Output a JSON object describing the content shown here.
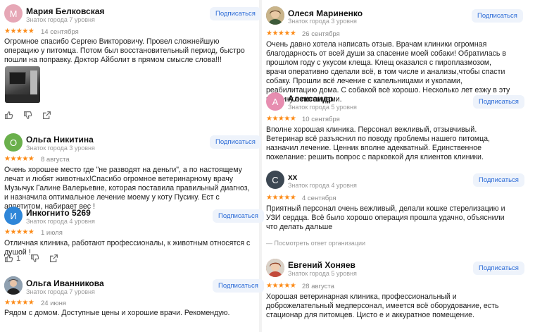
{
  "subscribe_label": "Подписаться",
  "left_reviews": [
    {
      "initial": "М",
      "avatar_color": "#e6a7b6",
      "name": "Мария Белковская",
      "level": "Знаток города 7 уровня",
      "stars": "★★★★★",
      "date": "14 сентября",
      "text": "Огромное спасибо Сергею Викторовичу. Провел сложнейшую операцию у питомца. Потом был восстановительный период, быстро пошли на поправку. Доктор Айболит в прямом смысле слова!!!"
    },
    {
      "initial": "О",
      "avatar_color": "#6ab04c",
      "name": "Ольга Никитина",
      "level": "Знаток города 3 уровня",
      "stars": "★★★★★",
      "date": "8 августа",
      "text": "Очень хорошее место где \"не разводят на деньги\", а по настоящему лечат и любят животных!Спасибо огромное ветеринарному врачу Музычук Галине Валерьевне, которая поставила правильный диагноз, и назначила оптимальное лечение моему у коту Пусику. Ест с аппетитом, набирает вес !"
    },
    {
      "initial": "И",
      "avatar_color": "#2f86d8",
      "name": "Инкогнито 5269",
      "level": "Знаток города 4 уровня",
      "stars": "★★★★★",
      "date": "1 июля",
      "text": "Отличная клиника, работают профессионалы, к животным относятся с душой !",
      "likes": "1"
    },
    {
      "initial": "",
      "avatar_color": "#5b6b7a",
      "name": "Ольга Иванникова",
      "level": "Знаток города 7 уровня",
      "stars": "★★★★★",
      "date": "24 июня",
      "text": "Рядом с домом. Доступные цены и хорошие врачи. Рекомендую."
    }
  ],
  "right_reviews": [
    {
      "initial": "",
      "avatar_color": "#7a6a4e",
      "name": "Олеся Мариненко",
      "level": "Знаток города 3 уровня",
      "stars": "★★★★★",
      "date": "26 сентября",
      "text": "Очень давно хотела написать отзыв. Врачам клиники огромная благодарность от всей души за спасение моей собаки! Обратилась в прошлом году с укусом клеща. Клещ оказался с пироплазмозом, врачи оперативно сделали всё, в том числе и анализы,чтобы спасти собаку. Прошли всё лечение с капельницами и уколами, реабилитацию дома. С собакой всё хорошо. Несколько лет езжу в эту клинику с питомцами."
    },
    {
      "initial": "А",
      "avatar_color": "#e78db0",
      "name": "Александр",
      "level": "Знаток города 5 уровня",
      "stars": "★★★★★",
      "date": "10 сентября",
      "text": "Вполне хорошая клиника. Персонал вежливый, отзывчивый. Ветеринар всё разъяснил по поводу проблемы нашего питомца, назначил лечение. Ценник вполне адекватный. Единственное пожелание: решить вопрос с парковкой для клиентов клиники."
    },
    {
      "initial": "С",
      "avatar_color": "#3c4752",
      "name": "хх",
      "level": "Знаток города 4 уровня",
      "stars": "★★★★★",
      "date": "4 сентября",
      "text": "Приятный персонал очень вежливый, делали кошке стерелизацию и УЗИ сердца. Всё было хорошо операция прошла удачно, объяснили что делать дальше",
      "org_reply": "Посмотреть ответ организации"
    },
    {
      "initial": "",
      "avatar_color": "#b5543a",
      "name": "Евгений Хоняев",
      "level": "Знаток города 5 уровня",
      "stars": "★★★★★",
      "date": "28 августа",
      "text": "Хорошая ветеринарная клиника, профессиональный и доброжелательный медперсонал, имеется всё оборудование, есть стационар для питомцев. Цисто е и аккуратное помещение."
    }
  ]
}
